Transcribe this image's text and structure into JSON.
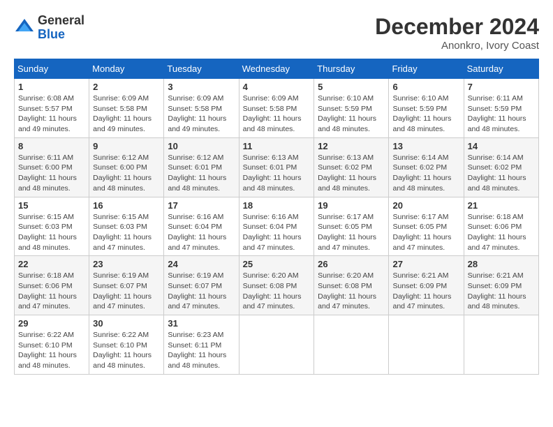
{
  "header": {
    "logo_line1": "General",
    "logo_line2": "Blue",
    "month_year": "December 2024",
    "location": "Anonkro, Ivory Coast"
  },
  "weekdays": [
    "Sunday",
    "Monday",
    "Tuesday",
    "Wednesday",
    "Thursday",
    "Friday",
    "Saturday"
  ],
  "weeks": [
    [
      {
        "day": "1",
        "sunrise": "6:08 AM",
        "sunset": "5:57 PM",
        "daylight": "11 hours and 49 minutes."
      },
      {
        "day": "2",
        "sunrise": "6:09 AM",
        "sunset": "5:58 PM",
        "daylight": "11 hours and 49 minutes."
      },
      {
        "day": "3",
        "sunrise": "6:09 AM",
        "sunset": "5:58 PM",
        "daylight": "11 hours and 49 minutes."
      },
      {
        "day": "4",
        "sunrise": "6:09 AM",
        "sunset": "5:58 PM",
        "daylight": "11 hours and 48 minutes."
      },
      {
        "day": "5",
        "sunrise": "6:10 AM",
        "sunset": "5:59 PM",
        "daylight": "11 hours and 48 minutes."
      },
      {
        "day": "6",
        "sunrise": "6:10 AM",
        "sunset": "5:59 PM",
        "daylight": "11 hours and 48 minutes."
      },
      {
        "day": "7",
        "sunrise": "6:11 AM",
        "sunset": "5:59 PM",
        "daylight": "11 hours and 48 minutes."
      }
    ],
    [
      {
        "day": "8",
        "sunrise": "6:11 AM",
        "sunset": "6:00 PM",
        "daylight": "11 hours and 48 minutes."
      },
      {
        "day": "9",
        "sunrise": "6:12 AM",
        "sunset": "6:00 PM",
        "daylight": "11 hours and 48 minutes."
      },
      {
        "day": "10",
        "sunrise": "6:12 AM",
        "sunset": "6:01 PM",
        "daylight": "11 hours and 48 minutes."
      },
      {
        "day": "11",
        "sunrise": "6:13 AM",
        "sunset": "6:01 PM",
        "daylight": "11 hours and 48 minutes."
      },
      {
        "day": "12",
        "sunrise": "6:13 AM",
        "sunset": "6:02 PM",
        "daylight": "11 hours and 48 minutes."
      },
      {
        "day": "13",
        "sunrise": "6:14 AM",
        "sunset": "6:02 PM",
        "daylight": "11 hours and 48 minutes."
      },
      {
        "day": "14",
        "sunrise": "6:14 AM",
        "sunset": "6:02 PM",
        "daylight": "11 hours and 48 minutes."
      }
    ],
    [
      {
        "day": "15",
        "sunrise": "6:15 AM",
        "sunset": "6:03 PM",
        "daylight": "11 hours and 48 minutes."
      },
      {
        "day": "16",
        "sunrise": "6:15 AM",
        "sunset": "6:03 PM",
        "daylight": "11 hours and 47 minutes."
      },
      {
        "day": "17",
        "sunrise": "6:16 AM",
        "sunset": "6:04 PM",
        "daylight": "11 hours and 47 minutes."
      },
      {
        "day": "18",
        "sunrise": "6:16 AM",
        "sunset": "6:04 PM",
        "daylight": "11 hours and 47 minutes."
      },
      {
        "day": "19",
        "sunrise": "6:17 AM",
        "sunset": "6:05 PM",
        "daylight": "11 hours and 47 minutes."
      },
      {
        "day": "20",
        "sunrise": "6:17 AM",
        "sunset": "6:05 PM",
        "daylight": "11 hours and 47 minutes."
      },
      {
        "day": "21",
        "sunrise": "6:18 AM",
        "sunset": "6:06 PM",
        "daylight": "11 hours and 47 minutes."
      }
    ],
    [
      {
        "day": "22",
        "sunrise": "6:18 AM",
        "sunset": "6:06 PM",
        "daylight": "11 hours and 47 minutes."
      },
      {
        "day": "23",
        "sunrise": "6:19 AM",
        "sunset": "6:07 PM",
        "daylight": "11 hours and 47 minutes."
      },
      {
        "day": "24",
        "sunrise": "6:19 AM",
        "sunset": "6:07 PM",
        "daylight": "11 hours and 47 minutes."
      },
      {
        "day": "25",
        "sunrise": "6:20 AM",
        "sunset": "6:08 PM",
        "daylight": "11 hours and 47 minutes."
      },
      {
        "day": "26",
        "sunrise": "6:20 AM",
        "sunset": "6:08 PM",
        "daylight": "11 hours and 47 minutes."
      },
      {
        "day": "27",
        "sunrise": "6:21 AM",
        "sunset": "6:09 PM",
        "daylight": "11 hours and 47 minutes."
      },
      {
        "day": "28",
        "sunrise": "6:21 AM",
        "sunset": "6:09 PM",
        "daylight": "11 hours and 48 minutes."
      }
    ],
    [
      {
        "day": "29",
        "sunrise": "6:22 AM",
        "sunset": "6:10 PM",
        "daylight": "11 hours and 48 minutes."
      },
      {
        "day": "30",
        "sunrise": "6:22 AM",
        "sunset": "6:10 PM",
        "daylight": "11 hours and 48 minutes."
      },
      {
        "day": "31",
        "sunrise": "6:23 AM",
        "sunset": "6:11 PM",
        "daylight": "11 hours and 48 minutes."
      },
      null,
      null,
      null,
      null
    ]
  ],
  "labels": {
    "sunrise": "Sunrise: ",
    "sunset": "Sunset: ",
    "daylight": "Daylight: "
  }
}
